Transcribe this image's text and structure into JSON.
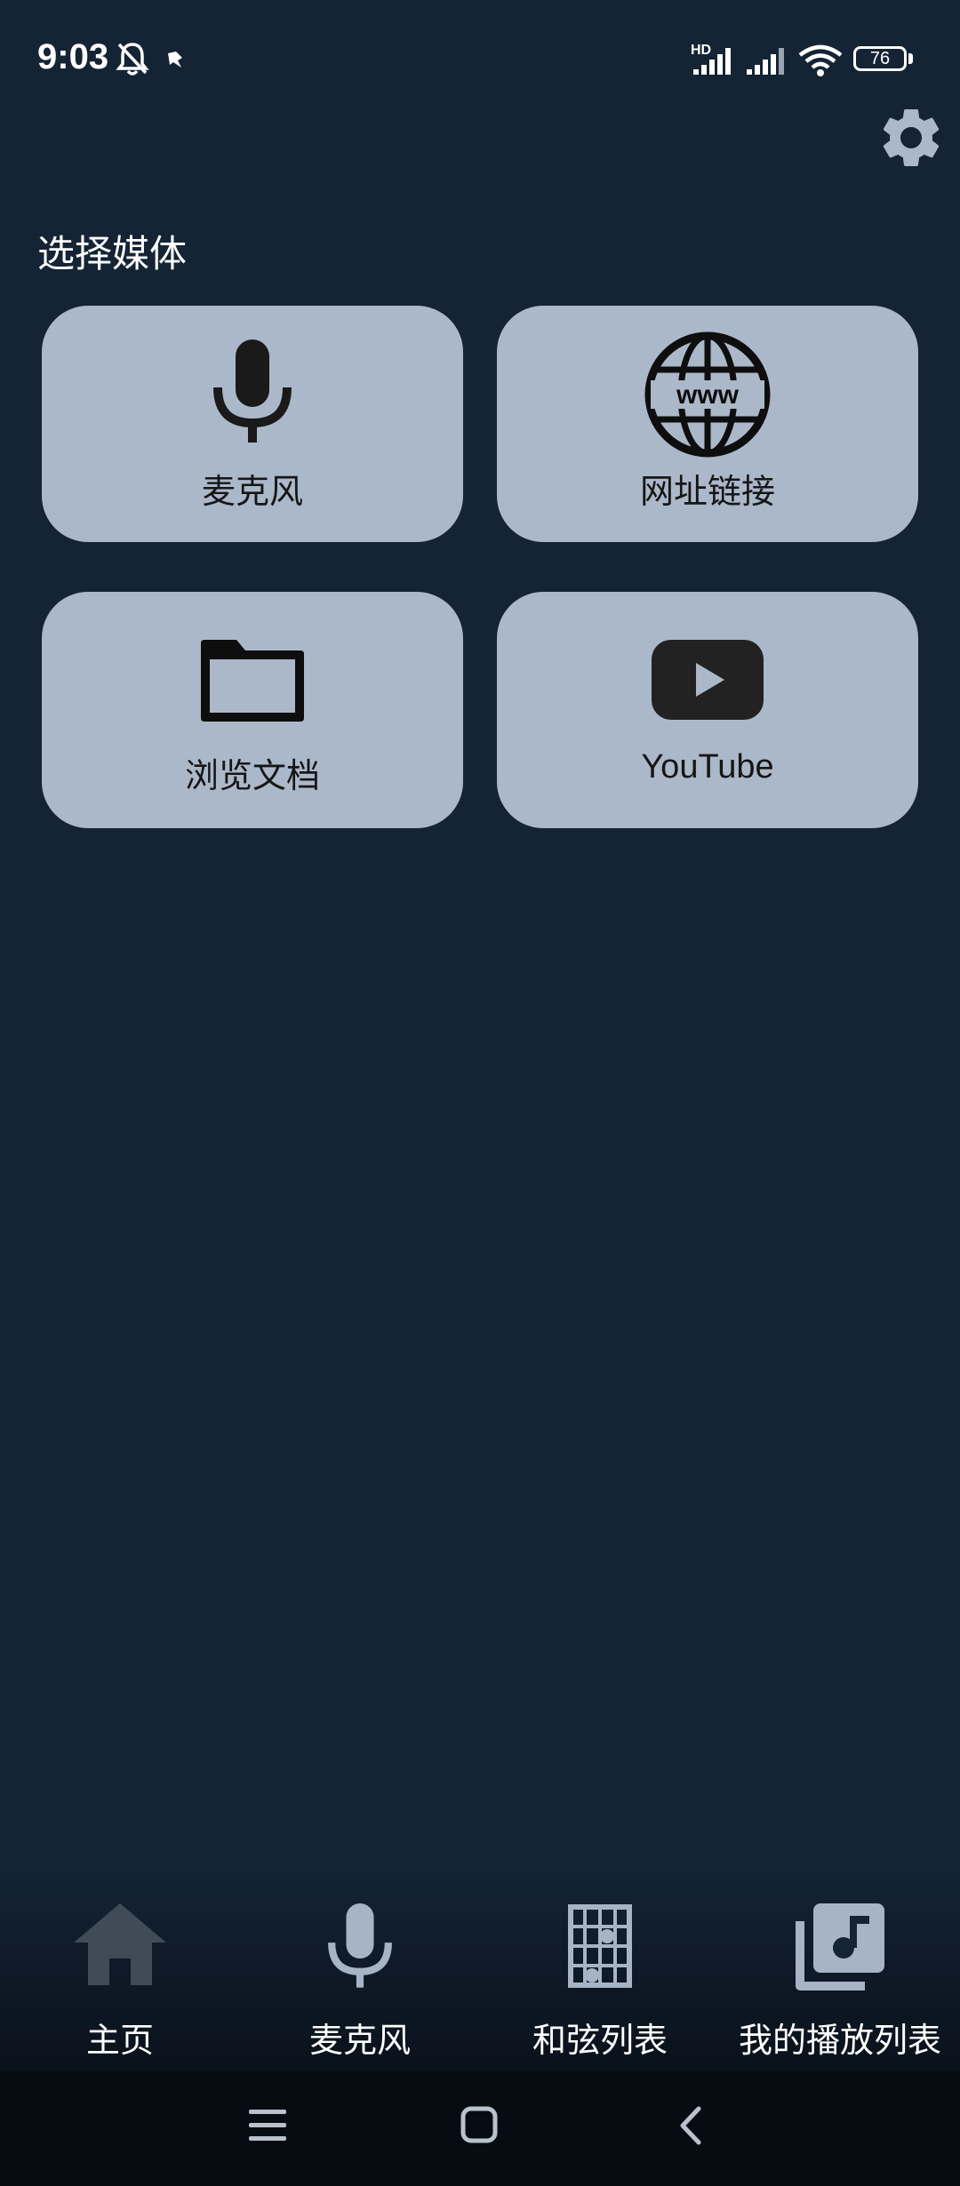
{
  "status_bar": {
    "time": "9:03",
    "network_type": "HD",
    "battery_level": "76"
  },
  "header": {
    "settings_icon": "gear-icon"
  },
  "main": {
    "section_title": "选择媒体",
    "cards": [
      {
        "label": "麦克风",
        "icon": "microphone-icon"
      },
      {
        "label": "网址链接",
        "icon": "globe-www-icon"
      },
      {
        "label": "浏览文档",
        "icon": "folder-icon"
      },
      {
        "label": "YouTube",
        "icon": "youtube-icon"
      }
    ]
  },
  "bottom_nav": {
    "items": [
      {
        "label": "主页",
        "icon": "home-icon",
        "active": true
      },
      {
        "label": "麦克风",
        "icon": "microphone-icon",
        "active": false
      },
      {
        "label": "和弦列表",
        "icon": "chord-grid-icon",
        "active": false
      },
      {
        "label": "我的播放列表",
        "icon": "playlist-music-icon",
        "active": false
      }
    ]
  },
  "colors": {
    "background": "#142435",
    "card": "#abb8ca",
    "card_text": "#161616",
    "nav_active_icon": "#404b58",
    "nav_inactive_icon": "#a7b4c5"
  }
}
